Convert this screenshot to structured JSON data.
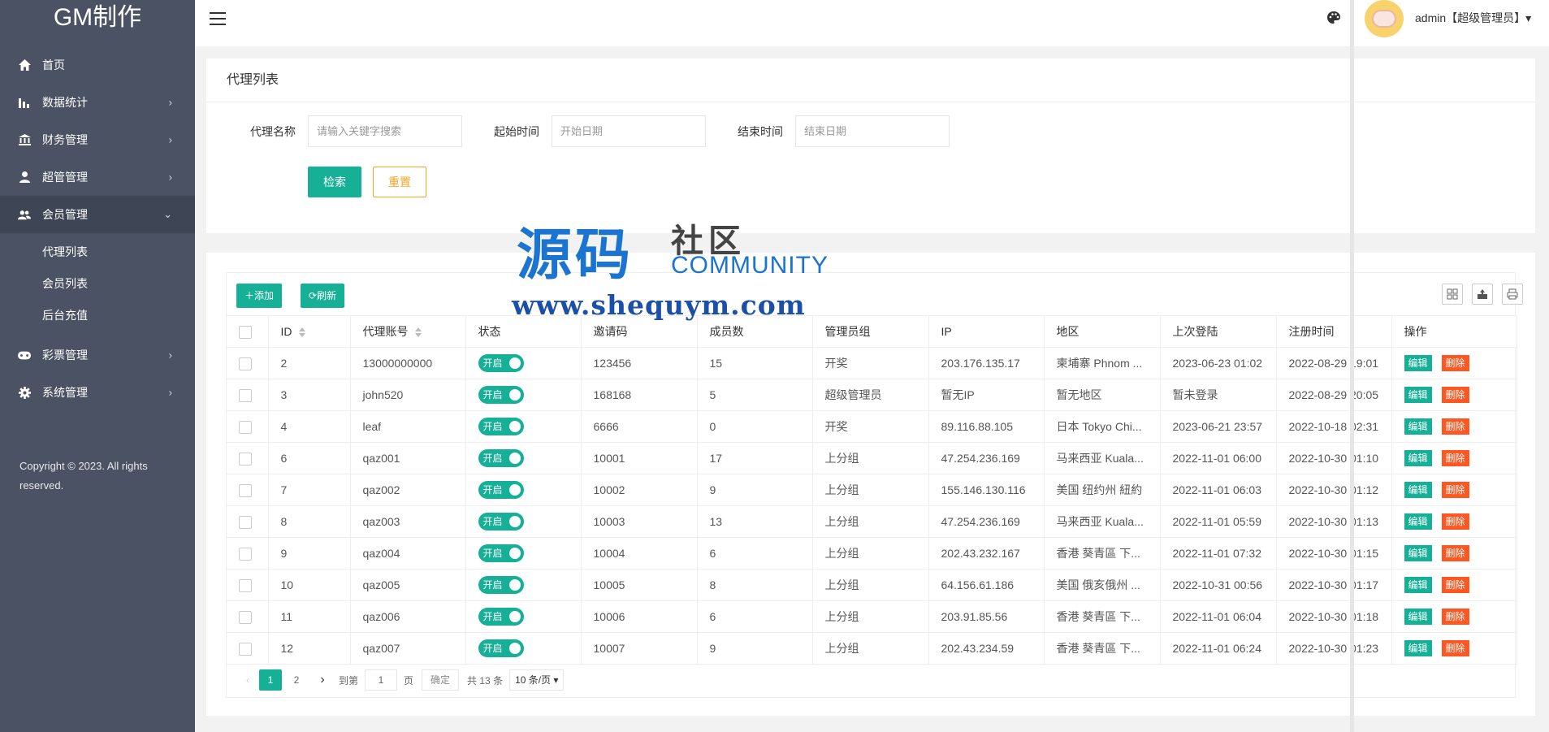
{
  "app": {
    "logo": "GM制作"
  },
  "sidebar": {
    "items": [
      {
        "label": "首页",
        "icon": "home-icon",
        "arrow": ""
      },
      {
        "label": "数据统计",
        "icon": "bar-chart-icon",
        "arrow": "›"
      },
      {
        "label": "财务管理",
        "icon": "bank-icon",
        "arrow": "›"
      },
      {
        "label": "超管管理",
        "icon": "user-icon",
        "arrow": "›"
      },
      {
        "label": "会员管理",
        "icon": "users-icon",
        "arrow": "⌄"
      }
    ],
    "sub_items": [
      "代理列表",
      "会员列表",
      "后台充值"
    ],
    "items_after": [
      {
        "label": "彩票管理",
        "icon": "gamepad-icon",
        "arrow": "›"
      },
      {
        "label": "系统管理",
        "icon": "gear-icon",
        "arrow": "›"
      }
    ],
    "copyright": "Copyright © 2023. All rights reserved."
  },
  "header": {
    "user": "admin【超级管理员】▾"
  },
  "search": {
    "title": "代理列表",
    "name_label": "代理名称",
    "name_placeholder": "请输入关键字搜索",
    "start_label": "起始时间",
    "start_placeholder": "开始日期",
    "end_label": "结束时间",
    "end_placeholder": "结束日期",
    "search_btn": "检索",
    "reset_btn": "重置"
  },
  "toolbar": {
    "add": "添加",
    "refresh": "刷新"
  },
  "table": {
    "headers": [
      "ID",
      "代理账号",
      "状态",
      "邀请码",
      "成员数",
      "管理员组",
      "IP",
      "地区",
      "上次登陆",
      "注册时间",
      "操作"
    ],
    "status_label": "开启",
    "edit_label": "编辑",
    "delete_label": "删除",
    "rows": [
      {
        "id": "2",
        "account": "13000000000",
        "code": "123456",
        "members": "15",
        "group": "开奖",
        "ip": "203.176.135.17",
        "region": "柬埔寨 Phnom ...",
        "last_login": "2023-06-23 01:02",
        "reg_time": "2022-08-29 19:01"
      },
      {
        "id": "3",
        "account": "john520",
        "code": "168168",
        "members": "5",
        "group": "超级管理员",
        "ip": "暂无IP",
        "region": "暂无地区",
        "last_login": "暂未登录",
        "reg_time": "2022-08-29 20:05"
      },
      {
        "id": "4",
        "account": "leaf",
        "code": "6666",
        "members": "0",
        "group": "开奖",
        "ip": "89.116.88.105",
        "region": "日本 Tokyo Chi...",
        "last_login": "2023-06-21 23:57",
        "reg_time": "2022-10-18 02:31"
      },
      {
        "id": "6",
        "account": "qaz001",
        "code": "10001",
        "members": "17",
        "group": "上分组",
        "ip": "47.254.236.169",
        "region": "马来西亚 Kuala...",
        "last_login": "2022-11-01 06:00",
        "reg_time": "2022-10-30 01:10"
      },
      {
        "id": "7",
        "account": "qaz002",
        "code": "10002",
        "members": "9",
        "group": "上分组",
        "ip": "155.146.130.116",
        "region": "美国 纽约州 紐約",
        "last_login": "2022-11-01 06:03",
        "reg_time": "2022-10-30 01:12"
      },
      {
        "id": "8",
        "account": "qaz003",
        "code": "10003",
        "members": "13",
        "group": "上分组",
        "ip": "47.254.236.169",
        "region": "马来西亚 Kuala...",
        "last_login": "2022-11-01 05:59",
        "reg_time": "2022-10-30 01:13"
      },
      {
        "id": "9",
        "account": "qaz004",
        "code": "10004",
        "members": "6",
        "group": "上分组",
        "ip": "202.43.232.167",
        "region": "香港 葵青區 下...",
        "last_login": "2022-11-01 07:32",
        "reg_time": "2022-10-30 01:15"
      },
      {
        "id": "10",
        "account": "qaz005",
        "code": "10005",
        "members": "8",
        "group": "上分组",
        "ip": "64.156.61.186",
        "region": "美国 俄亥俄州 ...",
        "last_login": "2022-10-31 00:56",
        "reg_time": "2022-10-30 01:17"
      },
      {
        "id": "11",
        "account": "qaz006",
        "code": "10006",
        "members": "6",
        "group": "上分组",
        "ip": "203.91.85.56",
        "region": "香港 葵青區 下...",
        "last_login": "2022-11-01 06:04",
        "reg_time": "2022-10-30 01:18"
      },
      {
        "id": "12",
        "account": "qaz007",
        "code": "10007",
        "members": "9",
        "group": "上分组",
        "ip": "202.43.234.59",
        "region": "香港 葵青區 下...",
        "last_login": "2022-11-01 06:24",
        "reg_time": "2022-10-30 01:23"
      }
    ]
  },
  "pagination": {
    "prev": "‹",
    "pages": [
      "1",
      "2"
    ],
    "next": "›",
    "goto_label": "到第",
    "goto_value": "1",
    "page_unit": "页",
    "confirm": "确定",
    "total": "共 13 条",
    "page_size": "10 条/页 ▾"
  },
  "watermark": {
    "cn_big": "源码",
    "cn_small": "社区",
    "en": "COMMUNITY",
    "url": "www.shequym.com"
  },
  "colors": {
    "sidebar": "#4a5263",
    "primary": "#16b097",
    "danger": "#ff5722",
    "warning": "#f5a623"
  }
}
